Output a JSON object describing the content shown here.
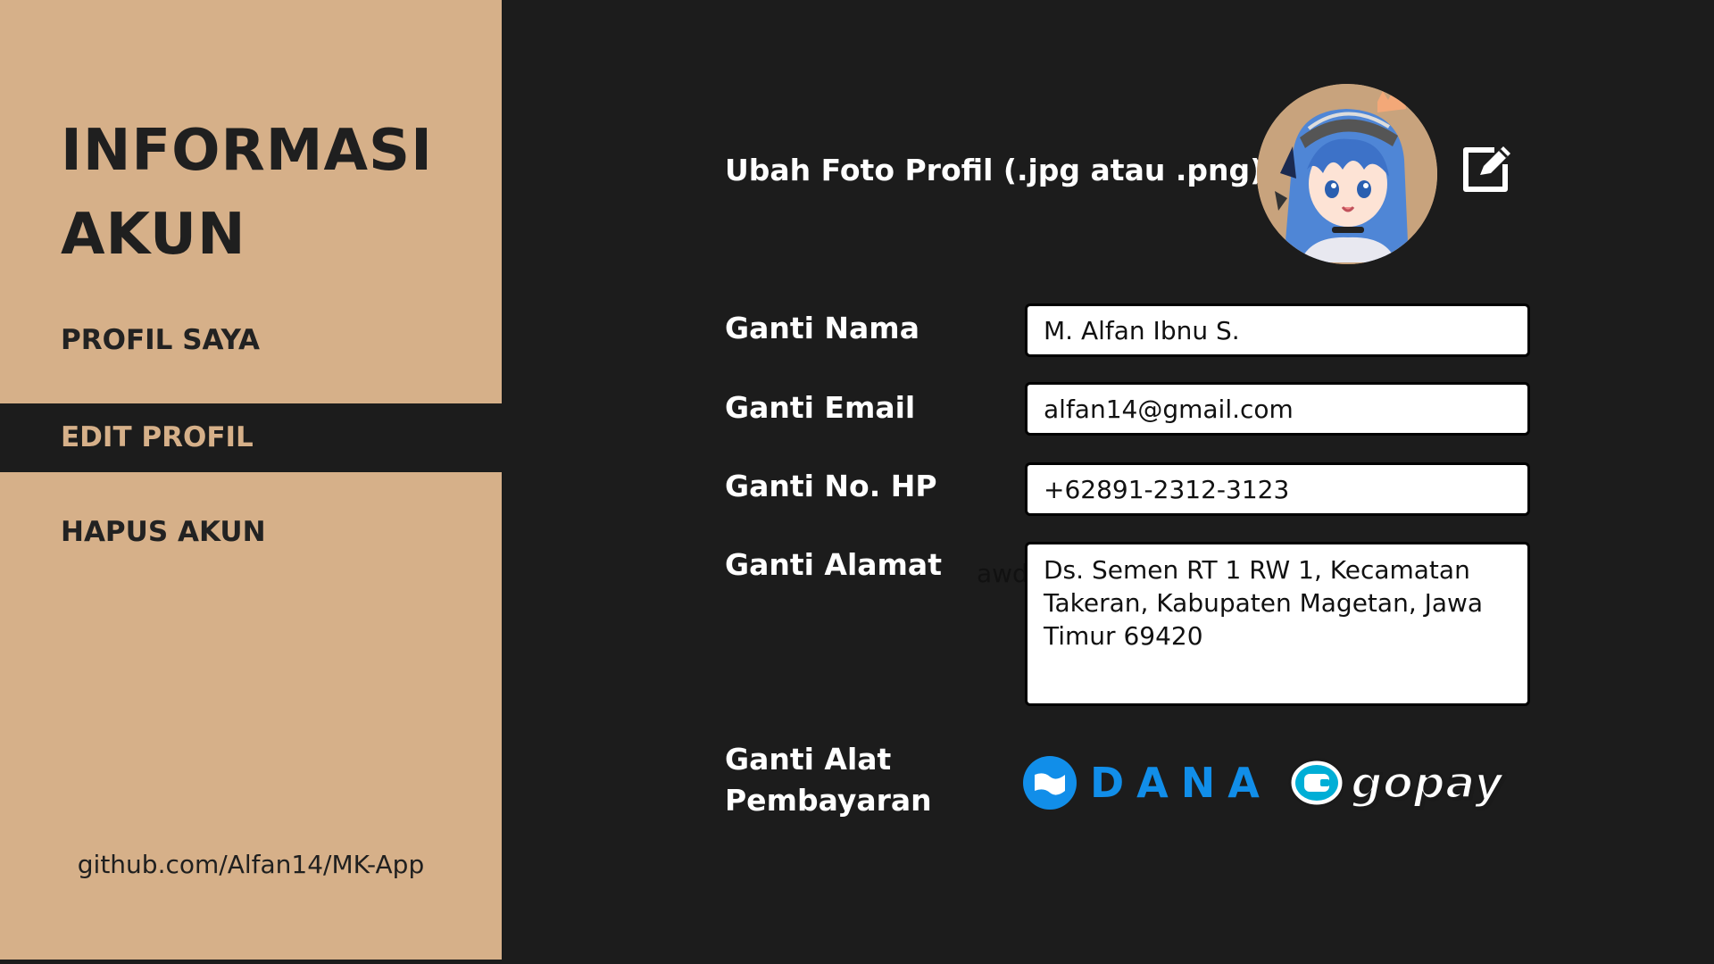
{
  "sidebar": {
    "title": "INFORMASI\nAKUN",
    "items": [
      {
        "label": "PROFIL SAYA",
        "active": false
      },
      {
        "label": "EDIT PROFIL",
        "active": true
      },
      {
        "label": "HAPUS AKUN",
        "active": false
      }
    ],
    "footer_link": "github.com/Alfan14/MK-App"
  },
  "main": {
    "photo_label": "Ubah Foto Profil (.jpg atau .png)",
    "fields": {
      "nama": {
        "label": "Ganti Nama",
        "value": "M. Alfan Ibnu S."
      },
      "email": {
        "label": "Ganti Email",
        "value": "alfan14@gmail.com"
      },
      "hp": {
        "label": "Ganti No. HP",
        "value": "+62891-2312-3123"
      },
      "alamat": {
        "label": "Ganti Alamat",
        "value": "Ds. Semen RT 1 RW 1, Kecamatan Takeran, Kabupaten Magetan, Jawa Timur 69420"
      }
    },
    "stray_text": "awd",
    "payment": {
      "label": "Ganti Alat\nPembayaran",
      "options": [
        {
          "name": "DANA",
          "icon": "dana-logo-icon"
        },
        {
          "name": "gopay",
          "icon": "gopay-logo-icon"
        }
      ]
    }
  },
  "colors": {
    "background": "#1c1c1c",
    "sidebar": "#d6b089",
    "dana_blue": "#118ee9",
    "gopay_blue": "#00aed6"
  }
}
